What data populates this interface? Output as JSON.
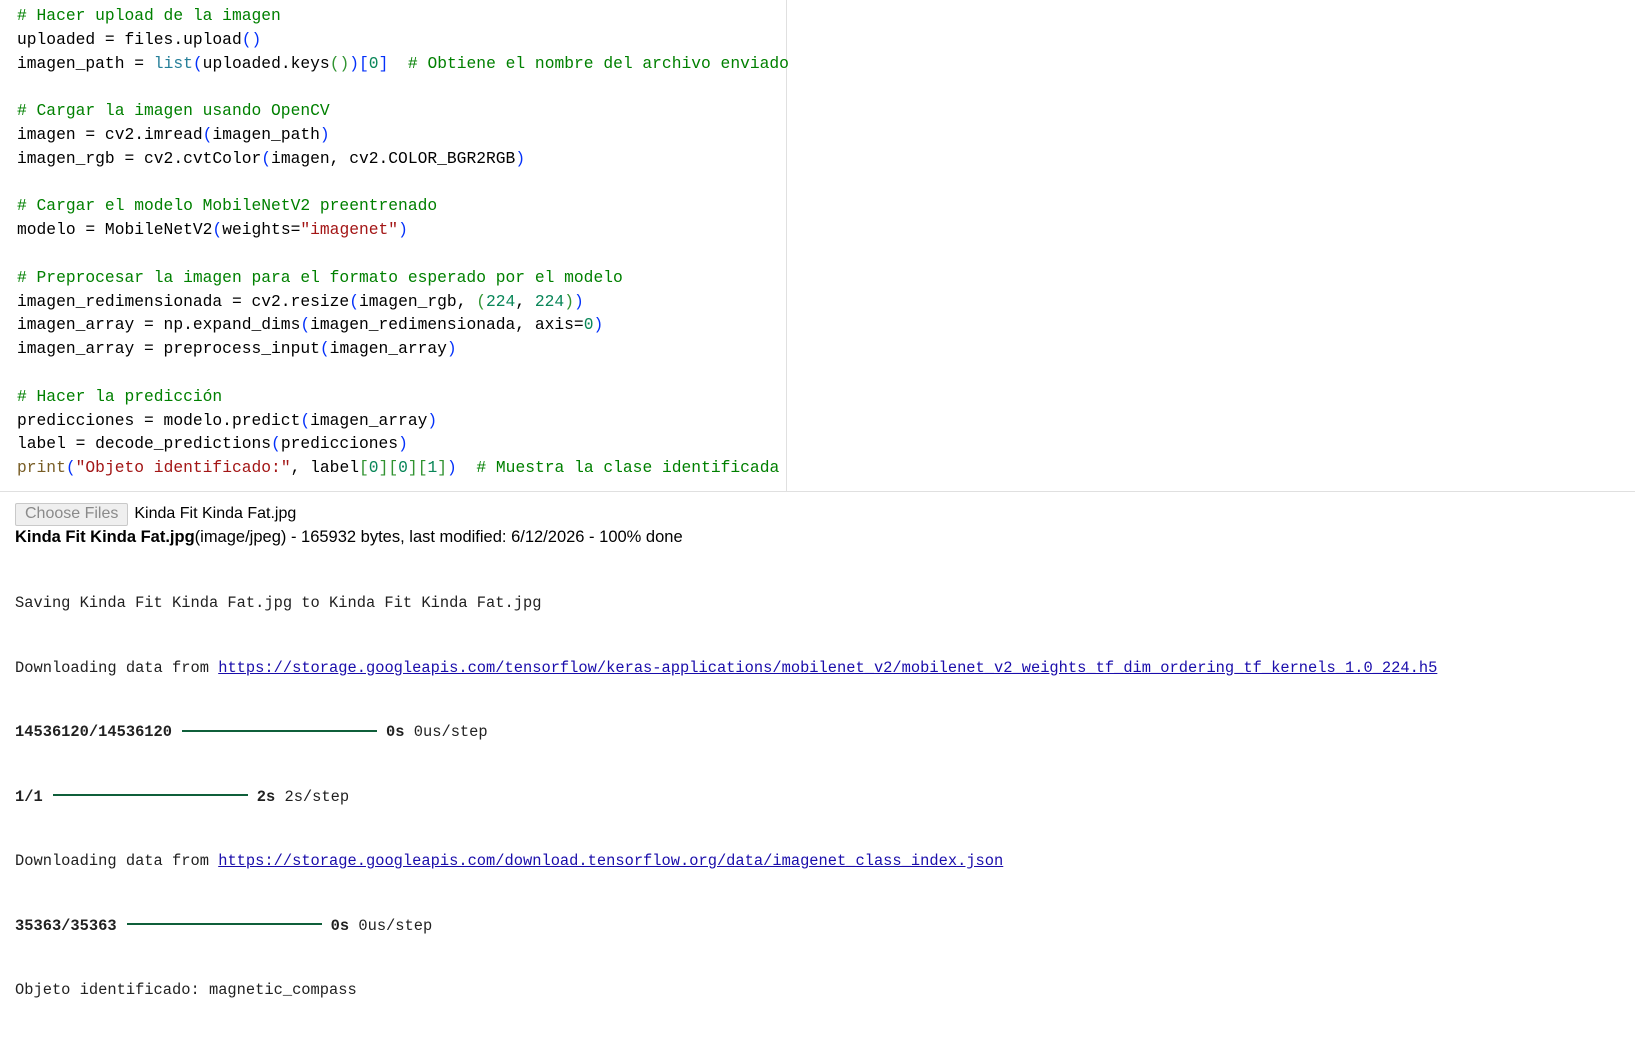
{
  "code": {
    "lines": [
      [
        {
          "t": "# Hacer upload de la imagen",
          "c": "cm"
        }
      ],
      [
        {
          "t": "uploaded = files.upload"
        },
        {
          "t": "()",
          "c": "br1"
        }
      ],
      [
        {
          "t": "imagen_path = "
        },
        {
          "t": "list",
          "c": "fn"
        },
        {
          "t": "(",
          "c": "br1"
        },
        {
          "t": "uploaded.keys"
        },
        {
          "t": "()",
          "c": "br2"
        },
        {
          "t": ")",
          "c": "br1"
        },
        {
          "t": "[",
          "c": "br1"
        },
        {
          "t": "0",
          "c": "nm"
        },
        {
          "t": "]",
          "c": "br1"
        },
        {
          "t": "  "
        },
        {
          "t": "# Obtiene el nombre del archivo enviado",
          "c": "cm"
        }
      ],
      [],
      [
        {
          "t": "# Cargar la imagen usando OpenCV",
          "c": "cm"
        }
      ],
      [
        {
          "t": "imagen = cv2.imread"
        },
        {
          "t": "(",
          "c": "br1"
        },
        {
          "t": "imagen_path"
        },
        {
          "t": ")",
          "c": "br1"
        }
      ],
      [
        {
          "t": "imagen_rgb = cv2.cvtColor"
        },
        {
          "t": "(",
          "c": "br1"
        },
        {
          "t": "imagen, cv2.COLOR_BGR2RGB"
        },
        {
          "t": ")",
          "c": "br1"
        }
      ],
      [],
      [
        {
          "t": "# Cargar el modelo MobileNetV2 preentrenado",
          "c": "cm"
        }
      ],
      [
        {
          "t": "modelo = MobileNetV2"
        },
        {
          "t": "(",
          "c": "br1"
        },
        {
          "t": "weights="
        },
        {
          "t": "\"imagenet\"",
          "c": "st"
        },
        {
          "t": ")",
          "c": "br1"
        }
      ],
      [],
      [
        {
          "t": "# Preprocesar la imagen para el formato esperado por el modelo",
          "c": "cm"
        }
      ],
      [
        {
          "t": "imagen_redimensionada = cv2.resize"
        },
        {
          "t": "(",
          "c": "br1"
        },
        {
          "t": "imagen_rgb, "
        },
        {
          "t": "(",
          "c": "br2"
        },
        {
          "t": "224",
          "c": "nm"
        },
        {
          "t": ", "
        },
        {
          "t": "224",
          "c": "nm"
        },
        {
          "t": ")",
          "c": "br2"
        },
        {
          "t": ")",
          "c": "br1"
        }
      ],
      [
        {
          "t": "imagen_array = np.expand_dims"
        },
        {
          "t": "(",
          "c": "br1"
        },
        {
          "t": "imagen_redimensionada, axis="
        },
        {
          "t": "0",
          "c": "nm"
        },
        {
          "t": ")",
          "c": "br1"
        }
      ],
      [
        {
          "t": "imagen_array = preprocess_input"
        },
        {
          "t": "(",
          "c": "br1"
        },
        {
          "t": "imagen_array"
        },
        {
          "t": ")",
          "c": "br1"
        }
      ],
      [],
      [
        {
          "t": "# Hacer la predicción",
          "c": "cm"
        }
      ],
      [
        {
          "t": "predicciones = modelo.predict"
        },
        {
          "t": "(",
          "c": "br1"
        },
        {
          "t": "imagen_array"
        },
        {
          "t": ")",
          "c": "br1"
        }
      ],
      [
        {
          "t": "label = decode_predictions"
        },
        {
          "t": "(",
          "c": "br1"
        },
        {
          "t": "predicciones"
        },
        {
          "t": ")",
          "c": "br1"
        }
      ],
      [
        {
          "t": "print",
          "c": "bi"
        },
        {
          "t": "(",
          "c": "br1"
        },
        {
          "t": "\"Objeto identificado:\"",
          "c": "st"
        },
        {
          "t": ", label"
        },
        {
          "t": "[",
          "c": "br2"
        },
        {
          "t": "0",
          "c": "nm"
        },
        {
          "t": "]",
          "c": "br2"
        },
        {
          "t": "[",
          "c": "br2"
        },
        {
          "t": "0",
          "c": "nm"
        },
        {
          "t": "]",
          "c": "br2"
        },
        {
          "t": "[",
          "c": "br2"
        },
        {
          "t": "1",
          "c": "nm"
        },
        {
          "t": "]",
          "c": "br2"
        },
        {
          "t": ")",
          "c": "br1"
        },
        {
          "t": "  "
        },
        {
          "t": "# Muestra la clase identificada",
          "c": "cm"
        }
      ]
    ]
  },
  "upload": {
    "button_label": "Choose Files",
    "chosen_file": "Kinda Fit Kinda Fat.jpg"
  },
  "file_info": {
    "name": "Kinda Fit Kinda Fat.jpg",
    "details": "(image/jpeg) - 165932 bytes, last modified: 6/12/2026 - 100% done"
  },
  "output": {
    "saving": "Saving Kinda Fit Kinda Fat.jpg to Kinda Fit Kinda Fat.jpg",
    "download1_prefix": "Downloading data from ",
    "download1_url": "https://storage.googleapis.com/tensorflow/keras-applications/mobilenet_v2/mobilenet_v2_weights_tf_dim_ordering_tf_kernels_1.0_224.h5",
    "progress1": {
      "count": "14536120/14536120",
      "time": "0s",
      "rate": "0us/step",
      "fraction": 1.0
    },
    "progress2": {
      "count": "1/1",
      "time": "2s",
      "rate": "2s/step",
      "fraction": 1.0
    },
    "download2_prefix": "Downloading data from ",
    "download2_url": "https://storage.googleapis.com/download.tensorflow.org/data/imagenet_class_index.json",
    "progress3": {
      "count": "35363/35363",
      "time": "0s",
      "rate": "0us/step",
      "fraction": 1.0
    },
    "result": "Objeto identificado: magnetic_compass"
  }
}
